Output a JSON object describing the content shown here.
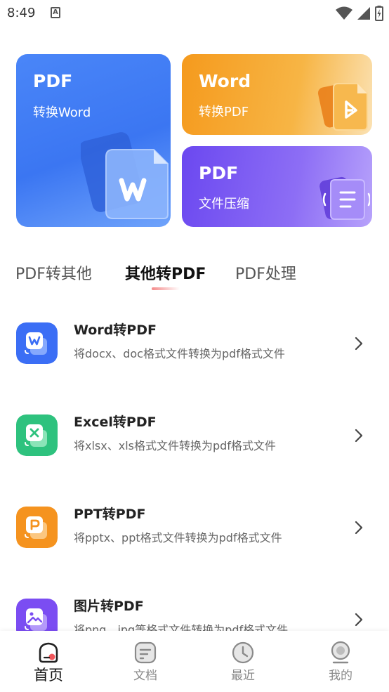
{
  "status_bar": {
    "time": "8:49",
    "notification_glyph": "A",
    "icons": [
      "wifi-icon",
      "signal-icon",
      "battery-icon"
    ]
  },
  "cards": {
    "pdf_to_word": {
      "title": "PDF",
      "subtitle": "转换Word",
      "color": "#3b76f2"
    },
    "word_to_pdf": {
      "title": "Word",
      "subtitle": "转换PDF",
      "color": "#f59a1d"
    },
    "compress": {
      "title": "PDF",
      "subtitle": "文件压缩",
      "color": "#6b48f0"
    }
  },
  "tabs": [
    {
      "label": "PDF转其他",
      "active": false
    },
    {
      "label": "其他转PDF",
      "active": true
    },
    {
      "label": "PDF处理",
      "active": false
    }
  ],
  "list": [
    {
      "icon": "word-icon",
      "title": "Word转PDF",
      "description": "将docx、doc格式文件转换为pdf格式文件",
      "color": "#3b6ef5"
    },
    {
      "icon": "excel-icon",
      "title": "Excel转PDF",
      "description": "将xlsx、xls格式文件转换为pdf格式文件",
      "color": "#2ec27e"
    },
    {
      "icon": "ppt-icon",
      "title": "PPT转PDF",
      "description": "将pptx、ppt格式文件转换为pdf格式文件",
      "color": "#f5931f"
    },
    {
      "icon": "image-icon",
      "title": "图片转PDF",
      "description": "将png、jpg等格式文件转换为pdf格式文件",
      "color": "#7b4df2"
    }
  ],
  "bottom_nav": [
    {
      "label": "首页",
      "icon": "home-icon",
      "active": true
    },
    {
      "label": "文档",
      "icon": "document-icon",
      "active": false
    },
    {
      "label": "最近",
      "icon": "clock-icon",
      "active": false
    },
    {
      "label": "我的",
      "icon": "profile-icon",
      "active": false
    }
  ],
  "colors": {
    "accent_red": "#f0555a",
    "tab_indicator": "#f48a8a"
  }
}
